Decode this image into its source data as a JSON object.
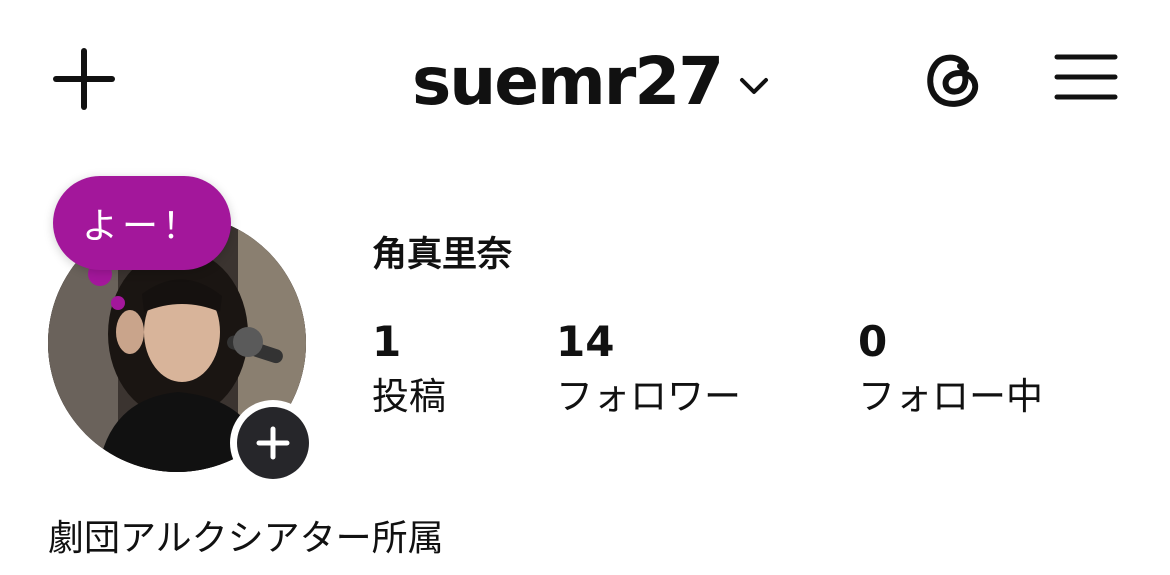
{
  "header": {
    "username": "suemr27",
    "icons": {
      "create": "plus-icon",
      "switch_account": "chevron-down-icon",
      "threads": "threads-icon",
      "menu": "hamburger-menu-icon"
    }
  },
  "note": {
    "text": "よー！",
    "color": "#a3179b"
  },
  "profile": {
    "display_name": "角真里奈",
    "bio": "劇団アルクシアター所属",
    "avatar_icon": "profile-photo",
    "add_story_icon": "plus-icon"
  },
  "stats": [
    {
      "count": "1",
      "label": "投稿"
    },
    {
      "count": "14",
      "label": "フォロワー"
    },
    {
      "count": "0",
      "label": "フォロー中"
    }
  ]
}
